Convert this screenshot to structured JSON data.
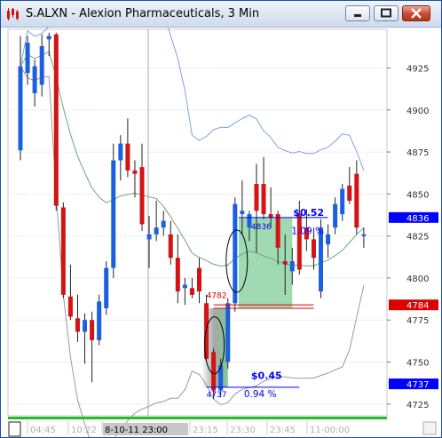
{
  "window": {
    "title": "S.ALXN - Alexion Pharmaceuticals, 3 Min",
    "buttons": [
      "minimize",
      "maximize",
      "close"
    ]
  },
  "chart_data": {
    "type": "candlestick",
    "symbol": "S.ALXN",
    "timeframe": "3 Min",
    "y_axis": {
      "ticks": [
        "4925",
        "4900",
        "4875",
        "4850",
        "4825",
        "4800",
        "4775",
        "4750",
        "4725"
      ],
      "ylim": [
        4718,
        4948
      ]
    },
    "x_axis": {
      "ticks": [
        "04:45",
        "10:22",
        "8-10-11  23:00",
        "23:15",
        "23:30",
        "23:45",
        "11-00:00"
      ],
      "highlighted_tick": "8-10-11  23:00"
    },
    "price_markers": [
      {
        "label": "4836",
        "value": 4836,
        "color": "#0000ff"
      },
      {
        "label": "4784",
        "value": 4784,
        "color": "#dd0000"
      },
      {
        "label": "4737",
        "value": 4737,
        "color": "#0000ff"
      }
    ],
    "annotations": [
      {
        "text": "$0.52",
        "color": "#0000ff"
      },
      {
        "text": "1.09 %",
        "color": "#0000ff"
      },
      {
        "text": "$0.45",
        "color": "#0000ff"
      },
      {
        "text": "0.94 %",
        "color": "#0000ff"
      },
      {
        "text": "4782",
        "color": "#dd0000"
      },
      {
        "text": "4836",
        "color": "#0000ff"
      },
      {
        "text": "4737",
        "color": "#0000ff"
      }
    ],
    "candles": [
      {
        "o": 4876,
        "h": 4944,
        "l": 4870,
        "c": 4926,
        "dir": "up"
      },
      {
        "o": 4922,
        "h": 4944,
        "l": 4915,
        "c": 4940,
        "dir": "up"
      },
      {
        "o": 4910,
        "h": 4930,
        "l": 4902,
        "c": 4926,
        "dir": "up"
      },
      {
        "o": 4915,
        "h": 4945,
        "l": 4908,
        "c": 4938,
        "dir": "up"
      },
      {
        "o": 4942,
        "h": 4946,
        "l": 4932,
        "c": 4944,
        "dir": "up"
      },
      {
        "o": 4945,
        "h": 4946,
        "l": 4840,
        "c": 4843,
        "dir": "down"
      },
      {
        "o": 4842,
        "h": 4845,
        "l": 4788,
        "c": 4790,
        "dir": "down"
      },
      {
        "o": 4789,
        "h": 4808,
        "l": 4775,
        "c": 4777,
        "dir": "down"
      },
      {
        "o": 4776,
        "h": 4790,
        "l": 4762,
        "c": 4768,
        "dir": "down"
      },
      {
        "o": 4768,
        "h": 4779,
        "l": 4749,
        "c": 4775,
        "dir": "up"
      },
      {
        "o": 4775,
        "h": 4780,
        "l": 4738,
        "c": 4763,
        "dir": "down"
      },
      {
        "o": 4763,
        "h": 4790,
        "l": 4760,
        "c": 4786,
        "dir": "up"
      },
      {
        "o": 4782,
        "h": 4810,
        "l": 4778,
        "c": 4806,
        "dir": "up"
      },
      {
        "o": 4806,
        "h": 4880,
        "l": 4800,
        "c": 4870,
        "dir": "up"
      },
      {
        "o": 4870,
        "h": 4885,
        "l": 4858,
        "c": 4880,
        "dir": "up"
      },
      {
        "o": 4880,
        "h": 4895,
        "l": 4860,
        "c": 4864,
        "dir": "down"
      },
      {
        "o": 4864,
        "h": 4870,
        "l": 4848,
        "c": 4862,
        "dir": "down"
      },
      {
        "o": 4866,
        "h": 4880,
        "l": 4828,
        "c": 4832,
        "dir": "down"
      },
      {
        "o": 4823,
        "h": 4837,
        "l": 4806,
        "c": 4826,
        "dir": "up"
      },
      {
        "o": 4826,
        "h": 4846,
        "l": 4822,
        "c": 4830,
        "dir": "up"
      },
      {
        "o": 4830,
        "h": 4840,
        "l": 4825,
        "c": 4834,
        "dir": "up"
      },
      {
        "o": 4826,
        "h": 4834,
        "l": 4808,
        "c": 4812,
        "dir": "down"
      },
      {
        "o": 4812,
        "h": 4826,
        "l": 4785,
        "c": 4792,
        "dir": "down"
      },
      {
        "o": 4794,
        "h": 4800,
        "l": 4784,
        "c": 4796,
        "dir": "up"
      },
      {
        "o": 4794,
        "h": 4800,
        "l": 4788,
        "c": 4790,
        "dir": "down"
      },
      {
        "o": 4806,
        "h": 4812,
        "l": 4785,
        "c": 4792,
        "dir": "down"
      },
      {
        "o": 4785,
        "h": 4790,
        "l": 4750,
        "c": 4752,
        "dir": "down"
      },
      {
        "o": 4756,
        "h": 4758,
        "l": 4728,
        "c": 4733,
        "dir": "down"
      },
      {
        "o": 4733,
        "h": 4752,
        "l": 4729,
        "c": 4748,
        "dir": "up"
      },
      {
        "o": 4750,
        "h": 4788,
        "l": 4746,
        "c": 4785,
        "dir": "up"
      },
      {
        "o": 4785,
        "h": 4848,
        "l": 4780,
        "c": 4844,
        "dir": "up"
      },
      {
        "o": 4840,
        "h": 4858,
        "l": 4826,
        "c": 4838,
        "dir": "up"
      },
      {
        "o": 4830,
        "h": 4840,
        "l": 4822,
        "c": 4838,
        "dir": "up"
      },
      {
        "o": 4840,
        "h": 4868,
        "l": 4815,
        "c": 4856,
        "dir": "down"
      },
      {
        "o": 4856,
        "h": 4872,
        "l": 4835,
        "c": 4838,
        "dir": "down"
      },
      {
        "o": 4836,
        "h": 4854,
        "l": 4830,
        "c": 4838,
        "dir": "down"
      },
      {
        "o": 4838,
        "h": 4840,
        "l": 4808,
        "c": 4818,
        "dir": "down"
      },
      {
        "o": 4808,
        "h": 4826,
        "l": 4790,
        "c": 4810,
        "dir": "down"
      },
      {
        "o": 4810,
        "h": 4818,
        "l": 4796,
        "c": 4804,
        "dir": "up"
      },
      {
        "o": 4805,
        "h": 4846,
        "l": 4802,
        "c": 4838,
        "dir": "down"
      },
      {
        "o": 4830,
        "h": 4841,
        "l": 4816,
        "c": 4823,
        "dir": "down"
      },
      {
        "o": 4823,
        "h": 4830,
        "l": 4805,
        "c": 4812,
        "dir": "down"
      },
      {
        "o": 4792,
        "h": 4835,
        "l": 4788,
        "c": 4830,
        "dir": "up"
      },
      {
        "o": 4820,
        "h": 4832,
        "l": 4812,
        "c": 4826,
        "dir": "up"
      },
      {
        "o": 4830,
        "h": 4848,
        "l": 4826,
        "c": 4844,
        "dir": "up"
      },
      {
        "o": 4838,
        "h": 4856,
        "l": 4834,
        "c": 4853,
        "dir": "up"
      },
      {
        "o": 4855,
        "h": 4866,
        "l": 4844,
        "c": 4846,
        "dir": "down"
      },
      {
        "o": 4862,
        "h": 4870,
        "l": 4826,
        "c": 4830,
        "dir": "down"
      },
      {
        "o": 4826,
        "h": 4830,
        "l": 4818,
        "c": 4825,
        "dir": "up"
      }
    ],
    "colors": {
      "up": "#1c5fe0",
      "down": "#d21414"
    }
  }
}
